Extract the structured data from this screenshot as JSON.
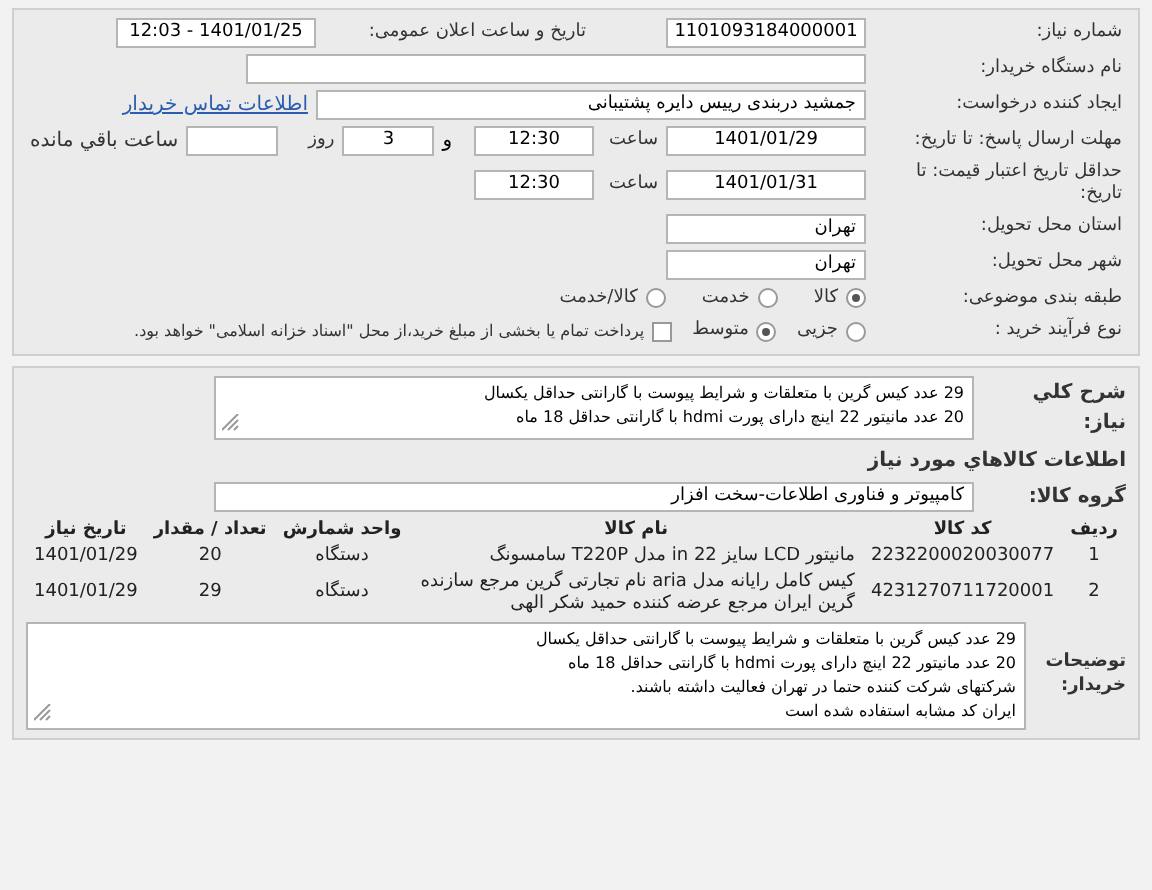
{
  "header": {
    "need_number": {
      "label": "شماره نیاز:",
      "value": "1101093184000001"
    },
    "announce": {
      "label": "تاریخ و ساعت اعلان عمومی:",
      "value": "1401/01/25 - 12:03"
    },
    "buyer_org": {
      "label": "نام دستگاه خریدار:"
    },
    "creator": {
      "label": "ایجاد کننده درخواست:",
      "value": "جمشید دربندی رییس دایره پشتیبانی",
      "link": "اطلاعات تماس خریدار"
    },
    "reply_deadline": {
      "label": "مهلت ارسال پاسخ: تا تاریخ:",
      "date": "1401/01/29",
      "time_label": "ساعت",
      "time": "12:30",
      "days": "3",
      "days_label": "روز",
      "and": "و",
      "remaining_label": "ساعت باقي مانده"
    },
    "price_validity": {
      "label": "حداقل تاریخ اعتبار قیمت: تا تاریخ:",
      "date": "1401/01/31",
      "time_label": "ساعت",
      "time": "12:30"
    },
    "province": {
      "label": "استان محل تحویل:",
      "value": "تهران"
    },
    "city": {
      "label": "شهر محل تحویل:",
      "value": "تهران"
    },
    "category": {
      "label": "طبقه بندی موضوعی:",
      "options": [
        {
          "label": "کالا",
          "selected": true
        },
        {
          "label": "خدمت",
          "selected": false
        },
        {
          "label": "کالا/خدمت",
          "selected": false
        }
      ]
    },
    "process": {
      "label": "نوع فرآیند خرید :",
      "options": [
        {
          "label": "جزیی",
          "selected": false
        },
        {
          "label": "متوسط",
          "selected": true
        }
      ],
      "treasury": {
        "label": "پرداخت تمام یا بخشی از مبلغ خرید،از محل \"اسناد خزانه اسلامی\" خواهد بود.",
        "checked": false
      }
    }
  },
  "description": {
    "label": "شرح کلي نیاز:",
    "lines": [
      "29 عدد کیس گرین با متعلقات و شرایط پیوست با گارانتی حداقل یکسال",
      "20 عدد مانیتور 22 اینچ دارای پورت hdmi با گارانتی حداقل 18 ماه"
    ]
  },
  "goods": {
    "heading": "اطلاعات کالاهاي مورد نیاز",
    "group": {
      "label": "گروه کالا:",
      "value": "کامپیوتر و فناوری اطلاعات-سخت افزار"
    },
    "columns": [
      "ردیف",
      "کد کالا",
      "نام کالا",
      "واحد شمارش",
      "تعداد / مقدار",
      "تاریخ نیاز"
    ],
    "rows": [
      [
        "1",
        "2232200020030077",
        "مانیتور LCD سایز 22 in مدل T220P سامسونگ",
        "دستگاه",
        "20",
        "1401/01/29"
      ],
      [
        "2",
        "4231270711720001",
        "کیس کامل رایانه مدل aria نام تجارتی گرین مرجع سازنده گرین ایران مرجع عرضه کننده حمید شکر الهی",
        "دستگاه",
        "29",
        "1401/01/29"
      ]
    ]
  },
  "buyer_notes": {
    "label": "توضیحات خریدار:",
    "lines": [
      "29 عدد کیس گرین با متعلقات و شرایط پیوست با گارانتی حداقل یکسال",
      "20 عدد مانیتور 22 اینچ دارای پورت hdmi با گارانتی حداقل 18 ماه",
      "شرکتهای شرکت کننده حتما در تهران فعالیت داشته باشند.",
      "ایران کد مشابه استفاده شده است"
    ]
  }
}
